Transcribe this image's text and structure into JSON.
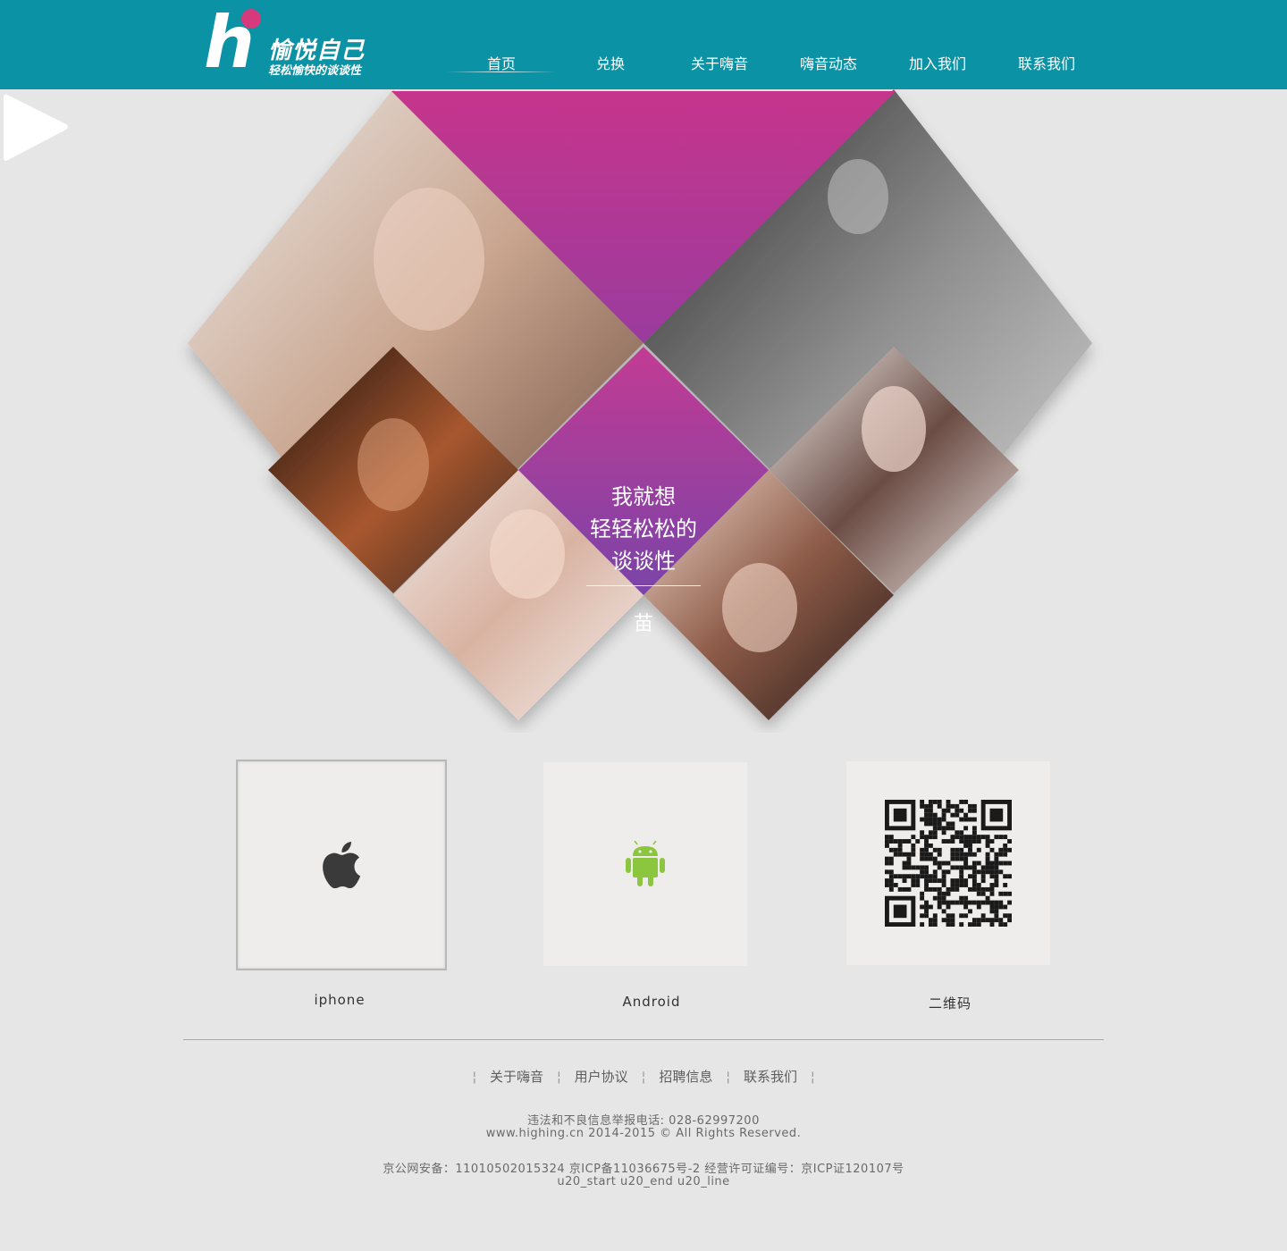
{
  "header": {
    "logo_letter": "h",
    "logo_title": "愉悦自己",
    "logo_subtitle": "轻松愉快的谈谈性",
    "nav": [
      {
        "label": "首页",
        "active": true
      },
      {
        "label": "兑换",
        "active": false
      },
      {
        "label": "关于嗨音",
        "active": false
      },
      {
        "label": "嗨音动态",
        "active": false
      },
      {
        "label": "加入我们",
        "active": false
      },
      {
        "label": "联系我们",
        "active": false
      }
    ]
  },
  "hero": {
    "slogan_lines": [
      "我就想",
      "轻轻松松的",
      "谈谈性"
    ],
    "author": "苗",
    "play_icon": "play-icon",
    "colors": {
      "accent_pink": "#c6358c",
      "accent_purple": "#8a3fa0"
    }
  },
  "downloads": [
    {
      "label": "iphone",
      "icon": "apple-icon"
    },
    {
      "label": "Android",
      "icon": "android-icon"
    },
    {
      "label": "二维码",
      "icon": "qr-code-icon"
    }
  ],
  "footer": {
    "links": [
      "关于嗨音",
      "用户协议",
      "招聘信息",
      "联系我们"
    ],
    "report_phone": "违法和不良信息举报电话: 028-62997200",
    "copyright": "www.highing.cn 2014-2015 © All Rights Reserved.",
    "license": "京公网安备：11010502015324 京ICP备11036675号-2 经营许可证编号：京ICP证120107号",
    "debug": "u20_start u20_end u20_line"
  },
  "colors": {
    "header_bg": "#0b92a5",
    "page_bg": "#e6e6e6",
    "android_green": "#8cc63f"
  }
}
